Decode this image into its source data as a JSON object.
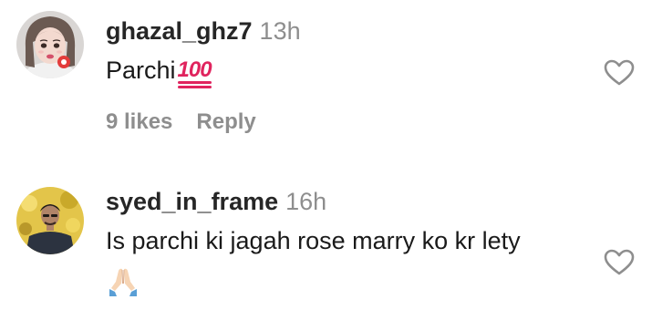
{
  "comments": [
    {
      "username": "ghazal_ghz7",
      "time": "13h",
      "text": "Parchi",
      "emoji": "100-emoji",
      "likes": "9 likes",
      "reply_label": "Reply",
      "icons": {
        "avatar": "avatar-girl-illustration",
        "like": "heart-outline-icon"
      }
    },
    {
      "username": "syed_in_frame",
      "time": "16h",
      "text": "Is parchi ki jagah rose marry ko kr lety",
      "emoji": "folded-hands-emoji",
      "icons": {
        "avatar": "avatar-man-photo",
        "like": "heart-outline-icon"
      }
    }
  ],
  "colors": {
    "username": "#262626",
    "secondary": "#8e8e8e",
    "text": "#1a1a1a",
    "hundred_red": "#e0245e"
  }
}
